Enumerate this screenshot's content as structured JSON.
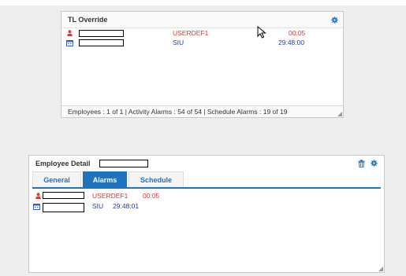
{
  "tl_override": {
    "title": "TL Override",
    "rows": [
      {
        "icon": "person-icon",
        "status": "USERDEF1",
        "time": "00:05",
        "color": "#e4352b"
      },
      {
        "icon": "calendar-icon",
        "status": "SIU",
        "time": "29:48:00",
        "color": "#1e3ea6"
      }
    ],
    "footer": "Employees : 1 of 1 | Activity Alarms : 54 of 54 | Schedule Alarms : 19 of 19"
  },
  "employee_detail": {
    "title": "Employee Detail",
    "tabs": [
      {
        "label": "General",
        "active": false
      },
      {
        "label": "Alarms",
        "active": true
      },
      {
        "label": "Schedule",
        "active": false
      }
    ],
    "rows": [
      {
        "icon": "person-icon",
        "status": "USERDEF1",
        "time": "00:05",
        "color": "#e4352b"
      },
      {
        "icon": "calendar-icon",
        "status": "SIU",
        "time": "29:48:01",
        "color": "#1e3ea6"
      }
    ]
  },
  "colors": {
    "accent": "#1e73be",
    "alarm_red": "#e4352b",
    "schedule_blue": "#1e3ea6"
  }
}
